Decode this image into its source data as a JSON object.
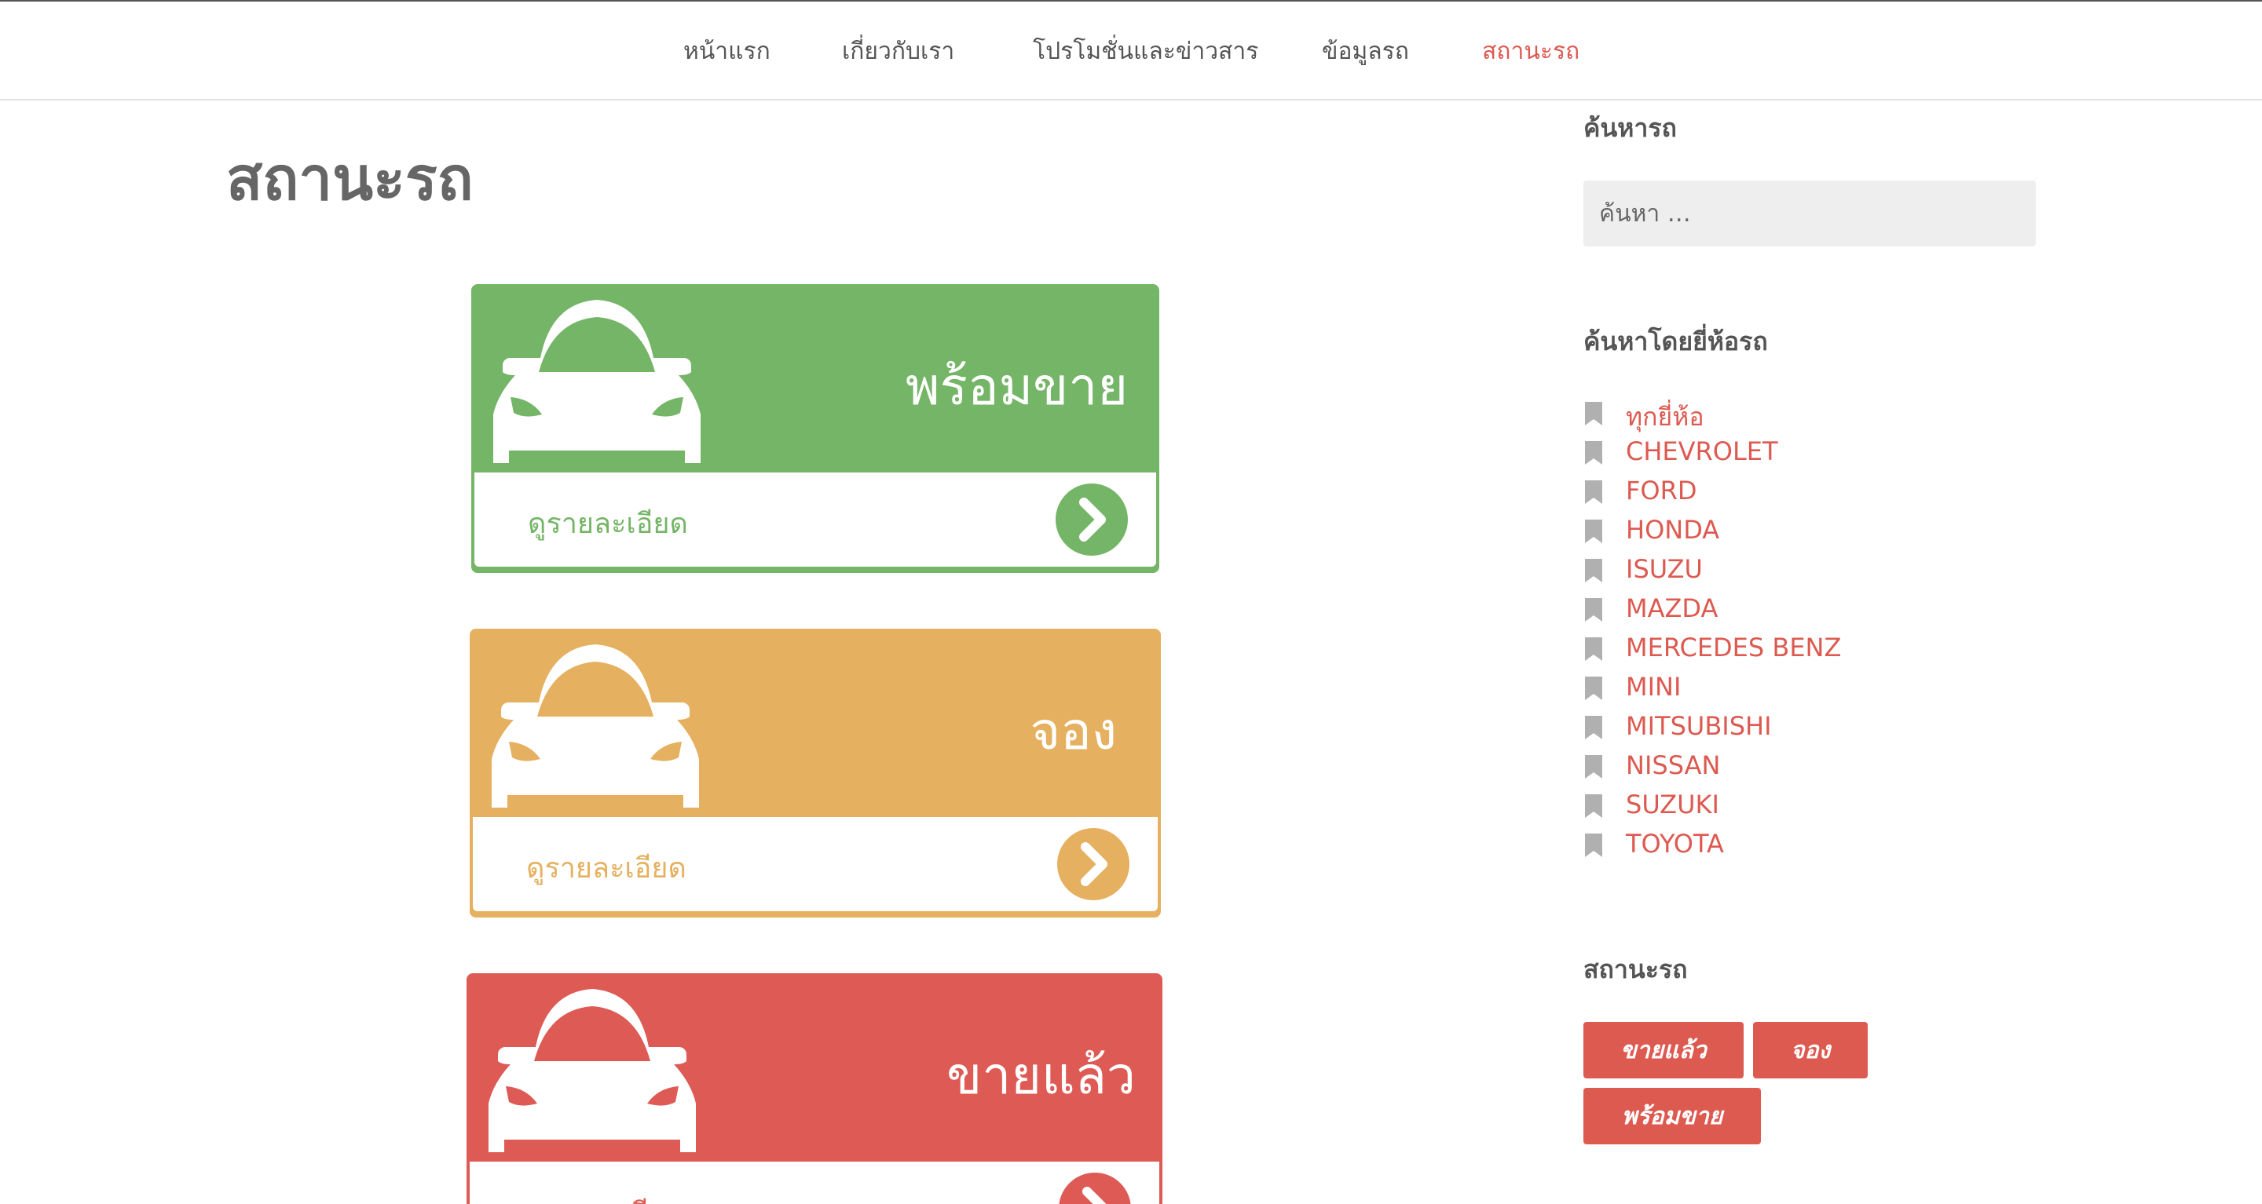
{
  "nav": {
    "items": [
      {
        "label": "หน้าแรก",
        "active": false
      },
      {
        "label": "เกี่ยวกับเรา",
        "active": false
      },
      {
        "label": "โปรโมชั่นและข่าวสาร",
        "active": false
      },
      {
        "label": "ข้อมูลรถ",
        "active": false
      },
      {
        "label": "สถานะรถ",
        "active": true
      }
    ]
  },
  "page": {
    "title": "สถานะรถ"
  },
  "cards": [
    {
      "status": "พร้อมขาย",
      "detail": "ดูรายละเอียด",
      "color": "#75b567"
    },
    {
      "status": "จอง",
      "detail": "ดูรายละเอียด",
      "color": "#e5b05f"
    },
    {
      "status": "ขายแล้ว",
      "detail": "ดูรายละเอียด",
      "color": "#de5b55"
    }
  ],
  "sidebar": {
    "search": {
      "title": "ค้นหารถ",
      "placeholder": "ค้นหา …"
    },
    "brands": {
      "title": "ค้นหาโดยยี่ห้อรถ",
      "items": [
        "ทุกยี่ห้อ",
        "CHEVROLET",
        "FORD",
        "HONDA",
        "ISUZU",
        "MAZDA",
        "MERCEDES BENZ",
        "MINI",
        "MITSUBISHI",
        "NISSAN",
        "SUZUKI",
        "TOYOTA"
      ]
    },
    "status": {
      "title": "สถานะรถ",
      "tags": [
        "ขายแล้ว",
        "จอง",
        "พร้อมขาย"
      ]
    }
  },
  "colors": {
    "accent": "#dd5a51",
    "text": "#555555",
    "search_bg": "#eeeeee",
    "bookmark_icon": "#b0b0b0"
  }
}
